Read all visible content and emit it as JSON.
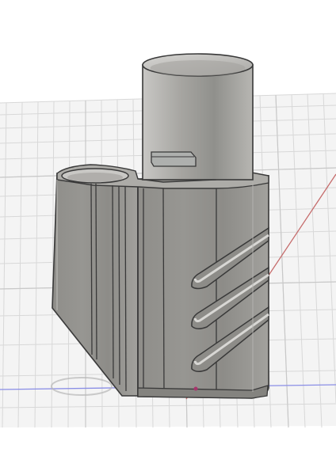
{
  "scene": {
    "type": "cad-3d-viewport",
    "model": "rendered-part",
    "colors": {
      "page": "#ffffff",
      "canvas": "#f4f4f4",
      "grid_minor": "#dadada",
      "grid_major": "#c8c8c8",
      "axis_x": "#c56a6a",
      "axis_y": "#8a8ee6",
      "model_light": "#b9b8b5",
      "model_mid": "#9f9e9a",
      "model_dark": "#757470",
      "edge": "#393939"
    }
  }
}
